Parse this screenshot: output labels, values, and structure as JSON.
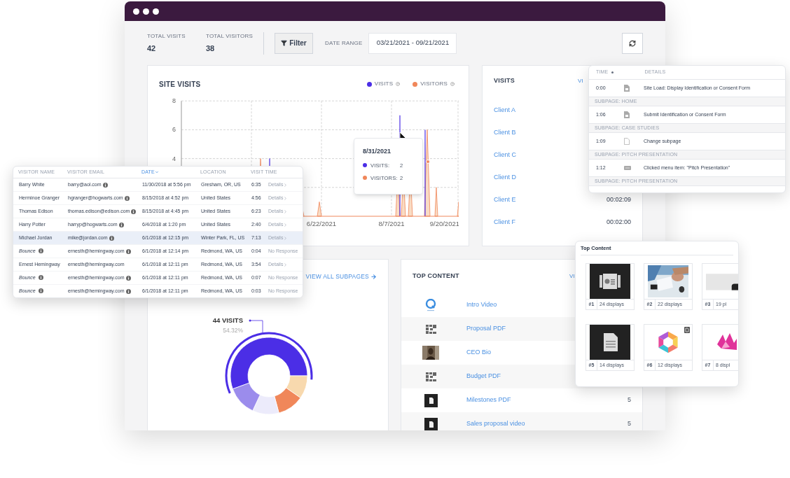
{
  "summary": {
    "stats": [
      {
        "label": "TOTAL VISITS",
        "value": "42"
      },
      {
        "label": "TOTAL VISITORS",
        "value": "38"
      }
    ],
    "filter_button": "Filter",
    "date_range_label": "DATE RANGE",
    "date_range": "03/21/2021 - 09/21/2021"
  },
  "site_visits": {
    "title": "SITE VISITS",
    "legend": [
      {
        "label": "VISITS",
        "color": "#4b2ee6"
      },
      {
        "label": "VISITORS",
        "color": "#f0875a"
      }
    ],
    "y_ticks": [
      "8",
      "6",
      "4"
    ],
    "x_labels": [
      "6/22/2021",
      "8/7/2021",
      "9/20/2021"
    ],
    "tooltip": {
      "date": "8/31/2021",
      "rows": [
        {
          "label": "VISITS:",
          "value": "2",
          "color": "#4b2ee6"
        },
        {
          "label": "VISITORS:",
          "value": "2",
          "color": "#f0875a"
        }
      ]
    }
  },
  "visits": {
    "title": "VISITS",
    "link": "VI",
    "clients": [
      {
        "name": "Client A"
      },
      {
        "name": "Client B"
      },
      {
        "name": "Client C"
      },
      {
        "name": "Client D"
      },
      {
        "name": "Client E",
        "time": "00:02:09"
      },
      {
        "name": "Client F",
        "time": "00:02:00"
      }
    ]
  },
  "subpages": {
    "link": "VIEW ALL SUBPAGES",
    "label": "44 VISITS",
    "percent": "54.32%"
  },
  "top_content": {
    "title": "TOP CONTENT",
    "link": "VI",
    "items": [
      {
        "name": "Intro Video",
        "kind": "round-logo"
      },
      {
        "name": "Proposal PDF",
        "kind": "block-logo"
      },
      {
        "name": "CEO Bio",
        "kind": "picture"
      },
      {
        "name": "Budget PDF",
        "kind": "block-logo"
      },
      {
        "name": "Milestones PDF",
        "kind": "document",
        "count": "5"
      },
      {
        "name": "Sales proposal video",
        "kind": "document",
        "count": "5"
      }
    ]
  },
  "visitor_table": {
    "columns": [
      {
        "label": "VISITOR NAME",
        "sorted": false
      },
      {
        "label": "VISITOR EMAIL",
        "sorted": false
      },
      {
        "label": "DATE",
        "sorted": true
      },
      {
        "label": "LOCATION",
        "sorted": false
      },
      {
        "label": "VISIT TIME",
        "sorted": false
      }
    ],
    "rows": [
      {
        "kind": "visitor",
        "name": "Barry White",
        "email": "barry@aol.com",
        "email_info": true,
        "date": "11/30/2018 at 5:56 pm",
        "location": "Gresham, OR, US",
        "time": "6:35",
        "action": "Details",
        "chevron": true,
        "highlighted": false
      },
      {
        "kind": "visitor",
        "name": "Herminoe Granger",
        "email": "hgranger@hogwarts.com",
        "email_info": true,
        "date": "8/15/2018 at 4:52 pm",
        "location": "United States",
        "time": "4:56",
        "action": "Details",
        "chevron": true,
        "highlighted": false
      },
      {
        "kind": "visitor",
        "name": "Thomas Edison",
        "email": "thomas.edison@edison.com",
        "email_info": true,
        "date": "8/15/2018 at 4:45 pm",
        "location": "United States",
        "time": "6:23",
        "action": "Details",
        "chevron": true,
        "highlighted": false
      },
      {
        "kind": "visitor",
        "name": "Harry Potter",
        "email": "harryp@hogwarts.com",
        "email_info": true,
        "date": "6/4/2018 at 1:20 pm",
        "location": "United States",
        "time": "2:40",
        "action": "Details",
        "chevron": true,
        "highlighted": false
      },
      {
        "kind": "visitor",
        "name": "Michael Jordan",
        "email": "mike@jordan.com",
        "email_info": true,
        "date": "6/1/2018 at 12:15 pm",
        "location": "Winter Park, FL, US",
        "time": "7:13",
        "action": "Details",
        "chevron": true,
        "highlighted": true
      },
      {
        "kind": "bounce",
        "name": "Bounce",
        "email": "ernesth@hemingway.com",
        "email_info": true,
        "date": "6/1/2018 at 12:14 pm",
        "location": "Redmond, WA, US",
        "time": "0:04",
        "action": "No Response",
        "chevron": false,
        "highlighted": false
      },
      {
        "kind": "visitor",
        "name": "Ernest Hemingway",
        "email": "ernesth@hemingway.com",
        "email_info": false,
        "date": "6/1/2018 at 12:11 pm",
        "location": "Redmond, WA, US",
        "time": "3:54",
        "action": "Details",
        "chevron": true,
        "highlighted": false
      },
      {
        "kind": "bounce",
        "name": "Bounce",
        "email": "ernesth@hemingway.com",
        "email_info": true,
        "date": "6/1/2018 at 12:11 pm",
        "location": "Redmond, WA, US",
        "time": "0:07",
        "action": "No Response",
        "chevron": false,
        "highlighted": false
      },
      {
        "kind": "bounce",
        "name": "Bounce",
        "email": "ernesth@hemingway.com",
        "email_info": true,
        "date": "6/1/2018 at 12:11 pm",
        "location": "Redmond, WA, US",
        "time": "0:03",
        "action": "No Response",
        "chevron": false,
        "highlighted": false
      }
    ]
  },
  "activity_log": {
    "columns": [
      "TIME",
      "DETAILS"
    ],
    "rows": [
      {
        "kind": "form-event",
        "time": "0:00",
        "details": "Site Load: Display Identification or Consent Form"
      },
      {
        "kind": "section",
        "label": "SUBPAGE: HOME"
      },
      {
        "kind": "form-event",
        "time": "1:06",
        "details": "Submit Identification or Consent Form"
      },
      {
        "kind": "section",
        "label": "SUBPAGE: CASE STUDIES"
      },
      {
        "kind": "page-event",
        "time": "1:09",
        "details": "Change subpage"
      },
      {
        "kind": "section",
        "label": "SUBPAGE: PITCH PRESENTATION"
      },
      {
        "kind": "menu-event",
        "time": "1:12",
        "details": "Clicked menu item: \"Pitch Presentation\""
      },
      {
        "kind": "section",
        "label": "SUBPAGE: PITCH PRESENTATION"
      }
    ]
  },
  "top_content_grid": {
    "title": "Top Content",
    "tiles": [
      {
        "rank": "#1",
        "displays": "24 displays",
        "kind": "presentation",
        "badge": false
      },
      {
        "rank": "#2",
        "displays": "22 displays",
        "kind": "picture",
        "badge": false
      },
      {
        "rank": "#3",
        "displays": "19 pl",
        "kind": "picture",
        "badge": false
      },
      {
        "rank": "#5",
        "displays": "14 displays",
        "kind": "document",
        "badge": false
      },
      {
        "rank": "#6",
        "displays": "12 displays",
        "kind": "hex-logo",
        "badge": true
      },
      {
        "rank": "#7",
        "displays": "8 displ",
        "kind": "crown-logo",
        "badge": false
      }
    ]
  }
}
